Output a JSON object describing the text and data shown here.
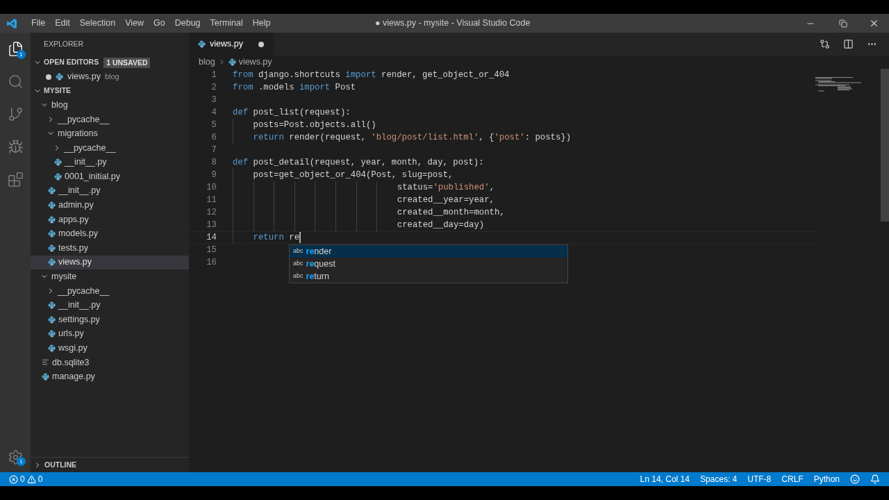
{
  "title_bar": {
    "menu": [
      "File",
      "Edit",
      "Selection",
      "View",
      "Go",
      "Debug",
      "Terminal",
      "Help"
    ],
    "title": "● views.py - mysite - Visual Studio Code"
  },
  "activity_bar": [
    {
      "kind": "files",
      "selected": true,
      "badge": "1"
    },
    {
      "kind": "search",
      "selected": false
    },
    {
      "kind": "source-control",
      "selected": false
    },
    {
      "kind": "debug",
      "selected": false
    },
    {
      "kind": "extensions",
      "selected": false
    }
  ],
  "manage": {
    "badge": "1"
  },
  "sidebar": {
    "title": "EXPLORER",
    "open_editors": {
      "label": "OPEN EDITORS",
      "badge": "1 UNSAVED",
      "expanded": true,
      "items": [
        {
          "name": "views.py",
          "folder": "blog",
          "dirty": true
        }
      ]
    },
    "project": {
      "label": "MYSITE",
      "expanded": true,
      "items": [
        {
          "name": "blog",
          "kind": "folder",
          "expanded": true,
          "selected": false,
          "children": [
            {
              "name": "__pycache__",
              "kind": "folder",
              "expanded": false,
              "selected": false
            },
            {
              "name": "migrations",
              "kind": "folder",
              "expanded": true,
              "selected": false,
              "children": [
                {
                  "name": "__pycache__",
                  "kind": "folder",
                  "expanded": false,
                  "selected": false
                },
                {
                  "name": "__init__.py",
                  "kind": "python",
                  "selected": false
                },
                {
                  "name": "0001_initial.py",
                  "kind": "python",
                  "selected": false
                }
              ]
            },
            {
              "name": "__init__.py",
              "kind": "python",
              "selected": false
            },
            {
              "name": "admin.py",
              "kind": "python",
              "selected": false
            },
            {
              "name": "apps.py",
              "kind": "python",
              "selected": false
            },
            {
              "name": "models.py",
              "kind": "python",
              "selected": false
            },
            {
              "name": "tests.py",
              "kind": "python",
              "selected": false
            },
            {
              "name": "views.py",
              "kind": "python",
              "selected": true
            }
          ]
        },
        {
          "name": "mysite",
          "kind": "folder",
          "expanded": true,
          "selected": false,
          "children": [
            {
              "name": "__pycache__",
              "kind": "folder",
              "expanded": false,
              "selected": false
            },
            {
              "name": "__init__.py",
              "kind": "python",
              "selected": false
            },
            {
              "name": "settings.py",
              "kind": "python",
              "selected": false
            },
            {
              "name": "urls.py",
              "kind": "python",
              "selected": false
            },
            {
              "name": "wsgi.py",
              "kind": "python",
              "selected": false
            }
          ]
        },
        {
          "name": "db.sqlite3",
          "kind": "file",
          "selected": false
        },
        {
          "name": "manage.py",
          "kind": "python",
          "selected": false
        }
      ]
    },
    "outline": {
      "label": "OUTLINE",
      "expanded": false
    }
  },
  "editor": {
    "tabs": [
      {
        "name": "views.py",
        "selected": true,
        "dirty": true
      }
    ],
    "breadcrumbs": [
      "blog",
      "views.py"
    ],
    "lines": [
      {
        "number": "1",
        "kind": "code",
        "current": false,
        "tokens": [
          {
            "kind": "keyword",
            "text": "from"
          },
          {
            "kind": "plain",
            "text": " django.shortcuts "
          },
          {
            "kind": "keyword",
            "text": "import"
          },
          {
            "kind": "plain",
            "text": " render, get_object_or_404"
          }
        ]
      },
      {
        "number": "2",
        "kind": "code",
        "current": false,
        "tokens": [
          {
            "kind": "keyword",
            "text": "from"
          },
          {
            "kind": "plain",
            "text": " .models "
          },
          {
            "kind": "keyword",
            "text": "import"
          },
          {
            "kind": "plain",
            "text": " Post"
          }
        ]
      },
      {
        "number": "3",
        "kind": "code",
        "current": false
      },
      {
        "number": "4",
        "kind": "code",
        "current": false,
        "tokens": [
          {
            "kind": "keyword",
            "text": "def"
          },
          {
            "kind": "plain",
            "text": " post_list(request):"
          }
        ],
        "children": [
          {
            "number": "5",
            "kind": "code",
            "current": false,
            "tokens": [
              {
                "kind": "plain",
                "text": "posts=Post.objects.all()"
              }
            ]
          },
          {
            "number": "6",
            "kind": "code",
            "current": false,
            "tokens": [
              {
                "kind": "keyword",
                "text": "return"
              },
              {
                "kind": "plain",
                "text": " render(request, "
              },
              {
                "kind": "string",
                "text": "'blog/post/list.html'"
              },
              {
                "kind": "plain",
                "text": ", {"
              },
              {
                "kind": "string",
                "text": "'post'"
              },
              {
                "kind": "plain",
                "text": ": posts})"
              }
            ]
          }
        ]
      },
      {
        "number": "7",
        "kind": "code",
        "current": false
      },
      {
        "number": "8",
        "kind": "code",
        "current": false,
        "tokens": [
          {
            "kind": "keyword",
            "text": "def"
          },
          {
            "kind": "plain",
            "text": " post_detail(request, year, month, day, post):"
          }
        ],
        "children": [
          {
            "number": "9",
            "kind": "code",
            "current": false,
            "tokens": [
              {
                "kind": "plain",
                "text": "post=get_object_or_404(Post, slug=post,"
              }
            ],
            "children": [
              {
                "number": "10",
                "kind": "continuation",
                "current": false,
                "tokens": [
                  {
                    "kind": "plain",
                    "text": "status="
                  },
                  {
                    "kind": "string",
                    "text": "'published'"
                  },
                  {
                    "kind": "plain",
                    "text": ","
                  }
                ]
              },
              {
                "number": "11",
                "kind": "continuation",
                "current": false,
                "tokens": [
                  {
                    "kind": "plain",
                    "text": "created__year=year,"
                  }
                ]
              },
              {
                "number": "12",
                "kind": "continuation",
                "current": false,
                "tokens": [
                  {
                    "kind": "plain",
                    "text": "created__month=month,"
                  }
                ]
              },
              {
                "number": "13",
                "kind": "continuation",
                "current": false,
                "tokens": [
                  {
                    "kind": "plain",
                    "text": "created__day=day)"
                  }
                ]
              }
            ]
          },
          {
            "number": "14",
            "kind": "code",
            "current": true,
            "tokens": [
              {
                "kind": "keyword",
                "text": "return"
              },
              {
                "kind": "plain",
                "text": " re"
              }
            ]
          }
        ]
      },
      {
        "number": "15",
        "kind": "code",
        "current": false
      },
      {
        "number": "16",
        "kind": "code",
        "current": false
      }
    ],
    "suggestions": [
      {
        "kind_label": "abc",
        "match": "re",
        "rest": "nder",
        "selected": true
      },
      {
        "kind_label": "abc",
        "match": "re",
        "rest": "quest",
        "selected": false
      },
      {
        "kind_label": "abc",
        "match": "re",
        "rest": "turn",
        "selected": false
      }
    ]
  },
  "status_bar": {
    "errors": "0",
    "warnings": "0",
    "right": [
      "Ln 14, Col 14",
      "Spaces: 4",
      "UTF-8",
      "CRLF",
      "Python"
    ]
  }
}
